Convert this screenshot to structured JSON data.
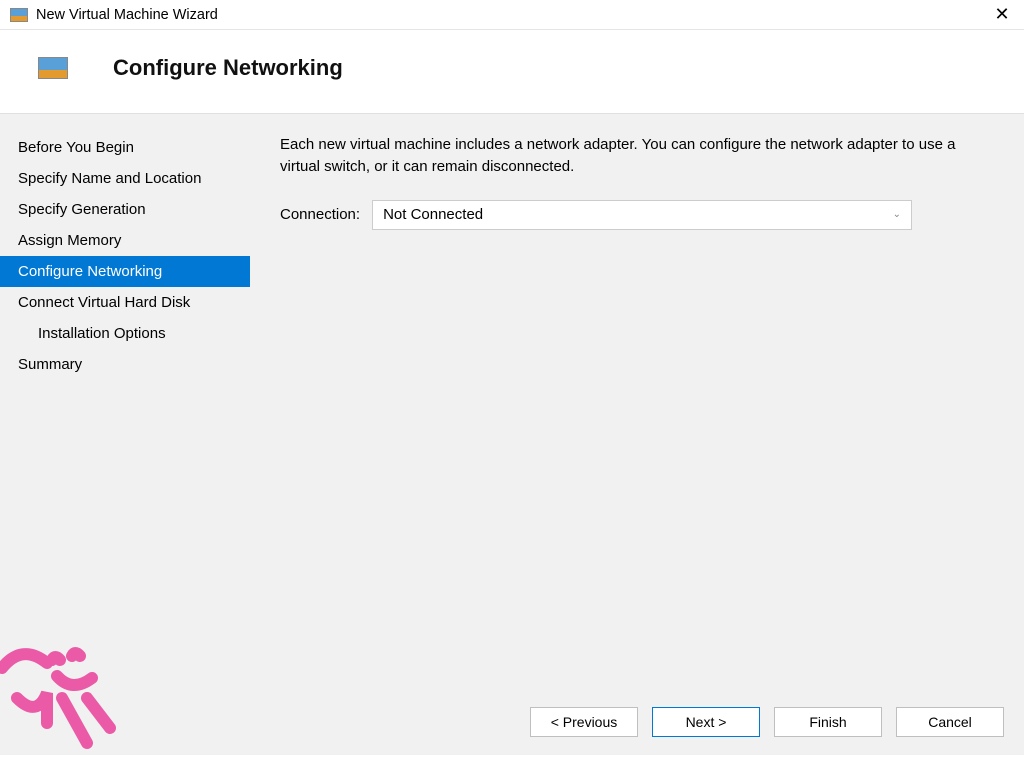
{
  "titlebar": {
    "title": "New Virtual Machine Wizard"
  },
  "header": {
    "title": "Configure Networking"
  },
  "sidebar": {
    "items": [
      {
        "label": "Before You Begin"
      },
      {
        "label": "Specify Name and Location"
      },
      {
        "label": "Specify Generation"
      },
      {
        "label": "Assign Memory"
      },
      {
        "label": "Configure Networking"
      },
      {
        "label": "Connect Virtual Hard Disk"
      },
      {
        "label": "Installation Options"
      },
      {
        "label": "Summary"
      }
    ]
  },
  "content": {
    "description": "Each new virtual machine includes a network adapter. You can configure the network adapter to use a virtual switch, or it can remain disconnected.",
    "connection_label": "Connection:",
    "connection_value": "Not Connected"
  },
  "buttons": {
    "previous": "< Previous",
    "next": "Next >",
    "finish": "Finish",
    "cancel": "Cancel"
  }
}
